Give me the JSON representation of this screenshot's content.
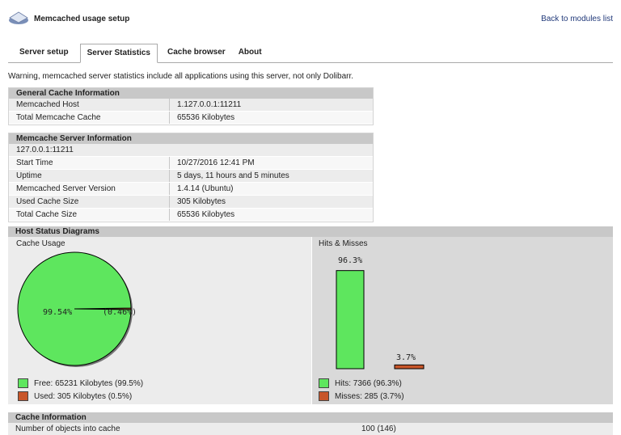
{
  "header": {
    "title": "Memcached usage setup",
    "back_link": "Back to modules list",
    "logo_icon": "memcached-logo-icon"
  },
  "tabs": [
    {
      "label": "Server setup",
      "active": false
    },
    {
      "label": "Server Statistics",
      "active": true
    },
    {
      "label": "Cache browser",
      "active": false
    },
    {
      "label": "About",
      "active": false
    }
  ],
  "warning": "Warning, memcached server statistics include all applications using this server, not only Dolibarr.",
  "general": {
    "title": "General Cache Information",
    "rows": [
      {
        "label": "Memcached Host",
        "value": "1.127.0.0.1:11211"
      },
      {
        "label": "Total Memcache Cache",
        "value": "65536 Kilobytes"
      }
    ]
  },
  "server": {
    "title": "Memcache Server Information",
    "host": "127.0.0.1:11211",
    "rows": [
      {
        "label": "Start Time",
        "value": "10/27/2016 12:41 PM"
      },
      {
        "label": "Uptime",
        "value": "5 days, 11 hours and 5 minutes"
      },
      {
        "label": "Memcached Server Version",
        "value": "1.4.14 (Ubuntu)"
      },
      {
        "label": "Used Cache Size",
        "value": "305 Kilobytes"
      },
      {
        "label": "Total Cache Size",
        "value": "65536 Kilobytes"
      }
    ]
  },
  "diagrams": {
    "title": "Host Status Diagrams",
    "cache_usage": {
      "label": "Cache Usage",
      "free_pct_label": "99.54%",
      "used_pct_label": "(0.46%)",
      "legend_free": "Free: 65231 Kilobytes (99.5%)",
      "legend_used": "Used: 305 Kilobytes (0.5%)"
    },
    "hits_misses": {
      "label": "Hits & Misses",
      "hits_label": "96.3%",
      "misses_label": "3.7%",
      "legend_hits": "Hits: 7366 (96.3%)",
      "legend_misses": "Misses: 285 (3.7%)"
    }
  },
  "chart_data": [
    {
      "type": "pie",
      "categories": [
        "Free",
        "Used"
      ],
      "values": [
        99.54,
        0.46
      ],
      "colors": [
        "#5ee65e",
        "#c8562a"
      ]
    },
    {
      "type": "bar",
      "categories": [
        "Hits",
        "Misses"
      ],
      "values": [
        96.3,
        3.7
      ],
      "ylim": [
        0,
        100
      ],
      "colors": [
        "#5ee65e",
        "#c8562a"
      ]
    }
  ],
  "cache_info": {
    "title": "Cache Information",
    "rows": [
      {
        "label": "Number of objects into cache",
        "value": "100 (146)"
      }
    ]
  },
  "colors": {
    "green": "#5ee65e",
    "orange": "#c8562a",
    "header_gray": "#c8c8c8",
    "link_blue": "#223a7a"
  }
}
